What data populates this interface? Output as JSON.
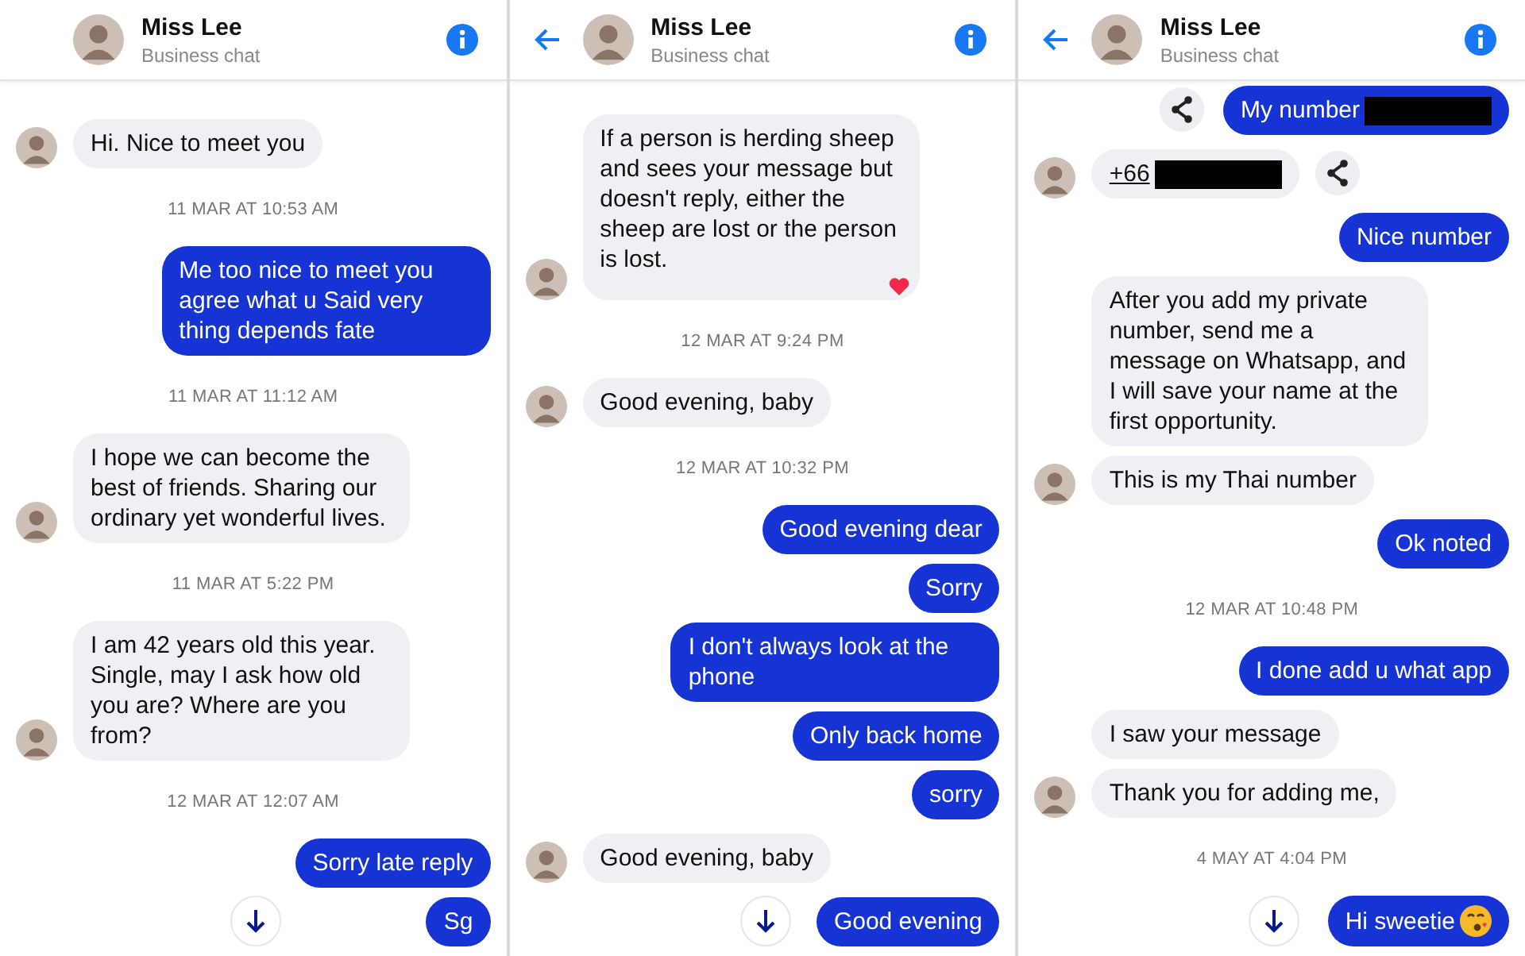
{
  "panels": [
    {
      "header": {
        "title": "Miss Lee",
        "subtitle": "Business chat",
        "back": false
      },
      "scroll_button": true,
      "messages": [
        {
          "kind": "in",
          "text": "Hi. Nice to meet you",
          "avatar": true
        },
        {
          "kind": "time",
          "text": "11 MAR AT 10:53 AM"
        },
        {
          "kind": "out",
          "text": "Me too nice to meet you agree what u Said very thing depends fate"
        },
        {
          "kind": "time",
          "text": "11 MAR AT 11:12 AM"
        },
        {
          "kind": "in",
          "text": "I hope we can become the best of friends. Sharing our ordinary yet wonderful lives.",
          "avatar": true
        },
        {
          "kind": "time",
          "text": "11 MAR AT 5:22 PM"
        },
        {
          "kind": "in",
          "text": "I am 42 years old this year. Single, may I ask how old you are? Where are you from?",
          "avatar": true
        },
        {
          "kind": "time",
          "text": "12 MAR AT 12:07 AM"
        },
        {
          "kind": "out",
          "text": "Sorry late reply"
        },
        {
          "kind": "out",
          "text": "Sg"
        }
      ]
    },
    {
      "header": {
        "title": "Miss Lee",
        "subtitle": "Business chat",
        "back": true
      },
      "scroll_button": true,
      "messages": [
        {
          "kind": "in",
          "text": "If a person is herding sheep and sees your message but doesn't reply, either the sheep are lost or the person is lost.",
          "avatar": true,
          "reaction": true
        },
        {
          "kind": "time",
          "text": "12 MAR AT 9:24 PM"
        },
        {
          "kind": "in",
          "text": "Good evening, baby",
          "avatar": true
        },
        {
          "kind": "time",
          "text": "12 MAR AT 10:32 PM"
        },
        {
          "kind": "out",
          "text": "Good evening dear"
        },
        {
          "kind": "out",
          "text": "Sorry"
        },
        {
          "kind": "out",
          "text": "I don't always look at the phone"
        },
        {
          "kind": "out",
          "text": "Only back home"
        },
        {
          "kind": "out",
          "text": "sorry"
        },
        {
          "kind": "in",
          "text": "Good evening, baby",
          "avatar": true
        },
        {
          "kind": "out",
          "text": "Good evening"
        }
      ]
    },
    {
      "header": {
        "title": "Miss Lee",
        "subtitle": "Business chat",
        "back": true
      },
      "scroll_button": true,
      "messages": [
        {
          "kind": "out",
          "text": "My number",
          "redacted": true,
          "share": true
        },
        {
          "kind": "in",
          "text": "+66",
          "redacted": true,
          "share": true,
          "link": true,
          "avatar": true
        },
        {
          "kind": "out",
          "text": "Nice number"
        },
        {
          "kind": "in",
          "text": "After you add my private number, send me a message on Whatsapp, and I will save your name at the first opportunity.",
          "avatar": false
        },
        {
          "kind": "in",
          "text": "This is my Thai number",
          "avatar": true
        },
        {
          "kind": "out",
          "text": "Ok noted"
        },
        {
          "kind": "time",
          "text": "12 MAR AT 10:48 PM"
        },
        {
          "kind": "out",
          "text": "I done add u what app"
        },
        {
          "kind": "in",
          "text": "I saw your message",
          "avatar": false
        },
        {
          "kind": "in",
          "text": "Thank you for adding me,",
          "avatar": true
        },
        {
          "kind": "time",
          "text": "4 MAY AT 4:04 PM"
        },
        {
          "kind": "out",
          "text": "Hi sweetie",
          "emoji": true
        }
      ]
    }
  ]
}
